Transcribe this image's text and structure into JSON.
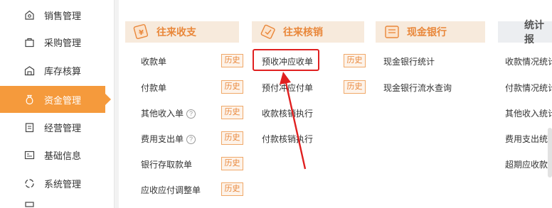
{
  "sidebar": {
    "items": [
      {
        "label": "销售管理",
        "icon": "store-icon"
      },
      {
        "label": "采购管理",
        "icon": "purchase-bag-icon"
      },
      {
        "label": "库存核算",
        "icon": "warehouse-icon"
      },
      {
        "label": "资金管理",
        "icon": "money-bag-icon",
        "active": true
      },
      {
        "label": "经营管理",
        "icon": "clipboard-icon"
      },
      {
        "label": "基础信息",
        "icon": "info-card-icon"
      },
      {
        "label": "系统管理",
        "icon": "system-ring-icon"
      }
    ]
  },
  "sections": {
    "receipts": {
      "title": "往来收支",
      "items": [
        {
          "label": "收款单",
          "history": "历史"
        },
        {
          "label": "付款单",
          "history": "历史"
        },
        {
          "label": "其他收入单",
          "help": "?",
          "history": "历史"
        },
        {
          "label": "费用支出单",
          "help": "?",
          "history": "历史"
        },
        {
          "label": "银行存取款单",
          "history": "历史"
        },
        {
          "label": "应收应付调整单",
          "history": "历史"
        }
      ]
    },
    "writeoff": {
      "title": "往来核销",
      "items": [
        {
          "label": "预收冲应收单",
          "history": "历史"
        },
        {
          "label": "预付冲应付单",
          "history": "历史"
        },
        {
          "label": "收款核销执行"
        },
        {
          "label": "付款核销执行"
        }
      ]
    },
    "cashbank": {
      "title": "现金银行",
      "items": [
        {
          "label": "现金银行统计"
        },
        {
          "label": "现金银行流水查询"
        }
      ]
    },
    "reports": {
      "title": "统计报",
      "items": [
        {
          "label": "收款情况统计"
        },
        {
          "label": "付款情况统计"
        },
        {
          "label": "其他收入统计"
        },
        {
          "label": "费用支出统计"
        },
        {
          "label": "超期应收款查"
        }
      ]
    }
  },
  "colors": {
    "accent": "#f59a3c",
    "highlight": "#e02020"
  }
}
